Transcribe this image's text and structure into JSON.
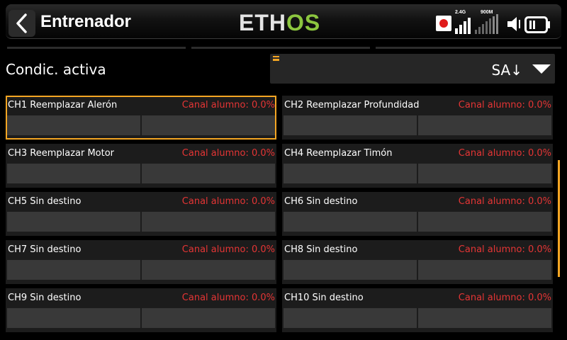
{
  "header": {
    "title": "Entrenador",
    "logo_main": "ETH",
    "logo_accent": "OS",
    "band_24": "2.4G",
    "band_900": "900M"
  },
  "condition": {
    "label": "Condic. activa",
    "value": "SA↓"
  },
  "channels": [
    {
      "label": "CH1 Reemplazar Alerón",
      "status": "Canal alumno: 0.0%"
    },
    {
      "label": "CH2 Reemplazar Profundidad",
      "status": "Canal alumno: 0.0%"
    },
    {
      "label": "CH3 Reemplazar Motor",
      "status": "Canal alumno: 0.0%"
    },
    {
      "label": "CH4 Reemplazar Timón",
      "status": "Canal alumno: 0.0%"
    },
    {
      "label": "CH5 Sin destino",
      "status": "Canal alumno: 0.0%"
    },
    {
      "label": "CH6 Sin destino",
      "status": "Canal alumno: 0.0%"
    },
    {
      "label": "CH7 Sin destino",
      "status": "Canal alumno: 0.0%"
    },
    {
      "label": "CH8 Sin destino",
      "status": "Canal alumno: 0.0%"
    },
    {
      "label": "CH9 Sin destino",
      "status": "Canal alumno: 0.0%"
    },
    {
      "label": "CH10 Sin destino",
      "status": "Canal alumno: 0.0%"
    }
  ],
  "icons": {
    "back": "chevron-left-icon",
    "record": "record-icon",
    "signal": "signal-bars-icon",
    "volume": "volume-icon",
    "battery": "battery-icon",
    "dropdown": "triangle-down-icon",
    "menu": "menu-icon"
  },
  "colors": {
    "accent": "#f5a623",
    "logo_green": "#8cc63f",
    "status_red": "#e53535",
    "card_bg": "#1c1c1c",
    "field_bg": "#393939"
  }
}
